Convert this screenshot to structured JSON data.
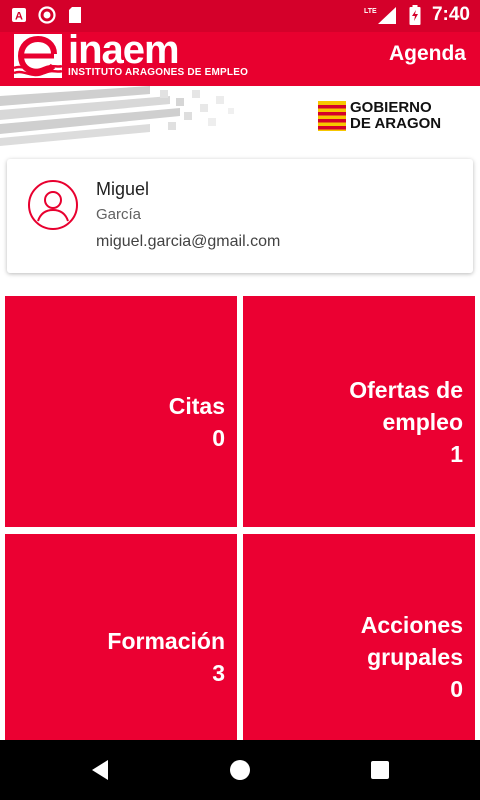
{
  "status_bar": {
    "time": "7:40",
    "icons": [
      "text-a-icon",
      "record-icon",
      "sd-card-icon",
      "lte-signal-icon",
      "signal-icon",
      "battery-charging-icon"
    ],
    "network": "LTE"
  },
  "app_bar": {
    "logo_word": "inaem",
    "logo_subtitle": "INSTITUTO ARAGONES DE EMPLEO",
    "title": "Agenda"
  },
  "banner": {
    "government_line1": "GOBIERNO",
    "government_line2": "DE ARAGON"
  },
  "profile": {
    "first_name": "Miguel",
    "last_name": "García",
    "email": "miguel.garcia@gmail.com"
  },
  "tiles": [
    {
      "label_line1": "Citas",
      "label_line2": "",
      "count": "0"
    },
    {
      "label_line1": "Ofertas de",
      "label_line2": "empleo",
      "count": "1"
    },
    {
      "label_line1": "Formación",
      "label_line2": "",
      "count": "3"
    },
    {
      "label_line1": "Acciones",
      "label_line2": "grupales",
      "count": "0"
    }
  ],
  "colors": {
    "status_bar": "#d4002a",
    "brand_red": "#e8002f",
    "tile_red": "#eb0032",
    "nav_bar": "#000000"
  }
}
